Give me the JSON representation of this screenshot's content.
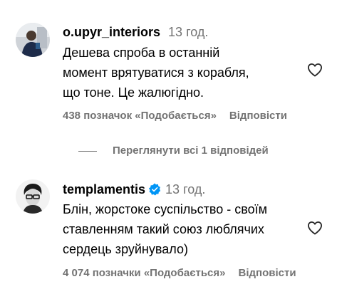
{
  "comments": [
    {
      "username": "o.upyr_interiors",
      "time": "13 год.",
      "verified": false,
      "lines": [
        "Дешева спроба в останній",
        "момент врятуватися з корабля,",
        "що тоне. Це жалюгідно."
      ],
      "likes": "438 позначок «Подобається»",
      "reply": "Відповісти"
    },
    {
      "username": "templamentis",
      "time": "13 год.",
      "verified": true,
      "lines": [
        "Блін, жорстоке суспільство - своїм",
        "ставленням такий союз люблячих",
        "сердець зруйнувало)"
      ],
      "likes": "4 074 позначки «Подобається»",
      "reply": "Відповісти"
    }
  ],
  "view_replies": "Переглянути всі 1 відповідей",
  "icons": {
    "like": "heart-outline-icon",
    "verified": "verified-badge-icon"
  },
  "colors": {
    "secondary_text": "#737373",
    "verified_blue": "#0095f6"
  }
}
